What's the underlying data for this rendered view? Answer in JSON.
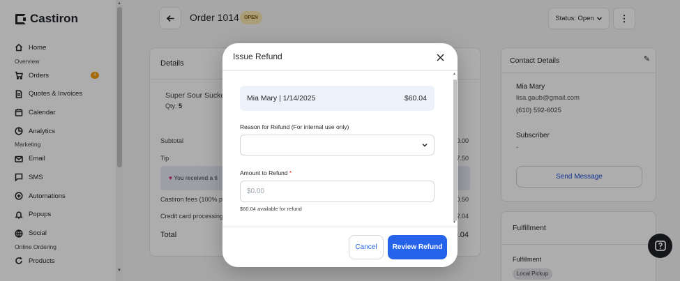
{
  "app": {
    "name": "Castiron"
  },
  "sidebar": {
    "sections": [
      {
        "label": "Overview"
      },
      {
        "label": "Marketing"
      },
      {
        "label": "Online Ordering"
      }
    ],
    "items": [
      {
        "label": "Home",
        "icon": "home-icon"
      },
      {
        "label": "Orders",
        "icon": "cart-icon",
        "badge": "4"
      },
      {
        "label": "Quotes & Invoices",
        "icon": "document-icon"
      },
      {
        "label": "Calendar",
        "icon": "calendar-icon"
      },
      {
        "label": "Analytics",
        "icon": "pie-chart-icon"
      },
      {
        "label": "Email",
        "icon": "mail-icon"
      },
      {
        "label": "SMS",
        "icon": "chat-icon"
      },
      {
        "label": "Automations",
        "icon": "plus-circle-icon"
      },
      {
        "label": "Popups",
        "icon": "bell-icon"
      },
      {
        "label": "Social",
        "icon": "globe-icon"
      },
      {
        "label": "Products",
        "icon": "refresh-icon"
      }
    ]
  },
  "header": {
    "title": "Order 1014",
    "status_badge": "OPEN",
    "status_button": "Status: Open"
  },
  "details": {
    "title": "Details",
    "item_name": "Super Sour Sucker",
    "qty_label": "Qty:",
    "qty_value": "5",
    "rows": [
      {
        "label": "Subtotal",
        "value": "0.00"
      },
      {
        "label": "Tip",
        "value": "7.50"
      },
      {
        "label": "Castiron fees (100% p",
        "value": "0.50"
      },
      {
        "label": "Credit card processing",
        "value": "2.04"
      }
    ],
    "tip_note": "You received a ti",
    "total_label": "Total",
    "total_value": "0.04"
  },
  "contact": {
    "title": "Contact Details",
    "name": "Mia Mary",
    "email": "lisa.gaub@gmail.com",
    "phone": "(610) 592-6025",
    "subscriber_label": "Subscriber",
    "subscriber_value": "-",
    "send_message": "Send Message"
  },
  "fulfillment": {
    "title": "Fulfillment",
    "label": "Fulfillment",
    "pill": "Local Pickup"
  },
  "modal": {
    "title": "Issue Refund",
    "summary_left": "Mia Mary | 1/14/2025",
    "summary_right": "$60.04",
    "reason_label": "Reason for Refund (For internal use only)",
    "reason_value": "",
    "amount_label": "Amount to Refund",
    "amount_required_mark": "*",
    "amount_placeholder": "$0.00",
    "amount_value": "",
    "available_hint": "$60.04 available for refund",
    "cancel_label": "Cancel",
    "review_label": "Review Refund"
  },
  "colors": {
    "primary": "#2563eb",
    "badge": "#f59e0b",
    "open_badge_bg": "#fbe7b0"
  }
}
